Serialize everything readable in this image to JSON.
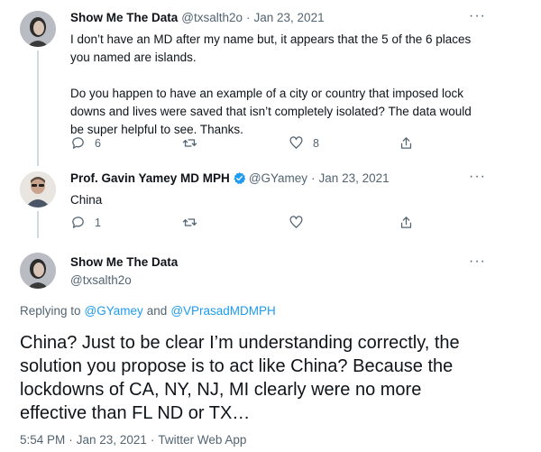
{
  "tweets": [
    {
      "name": "Show Me The Data",
      "handle": "@txsalth2o",
      "sep": "·",
      "date": "Jan 23, 2021",
      "more": "···",
      "text_p1_l1": "I don’t have an MD after my name but, it appears that the 5 of the 6 places",
      "text_p1_l2": "you named are islands.",
      "text_p2_l1": "Do you happen to have an example of a city or country that imposed lock",
      "text_p2_l2": "downs and lives were saved that isn’t completely isolated? The data would",
      "text_p2_l3": "be super helpful to see. Thanks.",
      "replies": "6",
      "retweets": "",
      "likes": "8"
    },
    {
      "name": "Prof. Gavin Yamey MD MPH",
      "handle": "@GYamey",
      "sep": "·",
      "date": "Jan 23, 2021",
      "more": "···",
      "text": "China",
      "replies": "1",
      "retweets": "",
      "likes": ""
    }
  ],
  "main_tweet": {
    "name": "Show Me The Data",
    "handle": "@txsalth2o",
    "more": "···",
    "replying_prefix": "Replying to",
    "replying_user1": "@GYamey",
    "replying_and": "and",
    "replying_user2": "@VPrasadMDMPH",
    "line1": "China? Just to be clear I’m understanding correctly, the",
    "line2": "solution you propose is to act like China? Because the",
    "line3": "lockdowns of CA, NY, NJ, MI clearly were no more",
    "line4": "effective than FL ND or TX…",
    "time": "5:54 PM",
    "sep": "·",
    "date": "Jan 23, 2021",
    "source": "Twitter Web App"
  },
  "colors": {
    "accent": "#1d9bf0",
    "secondary_text": "#536471",
    "primary_text": "#0f1419"
  },
  "icons": [
    "reply-icon",
    "retweet-icon",
    "like-icon",
    "share-icon",
    "verified-badge-icon",
    "more-icon"
  ]
}
